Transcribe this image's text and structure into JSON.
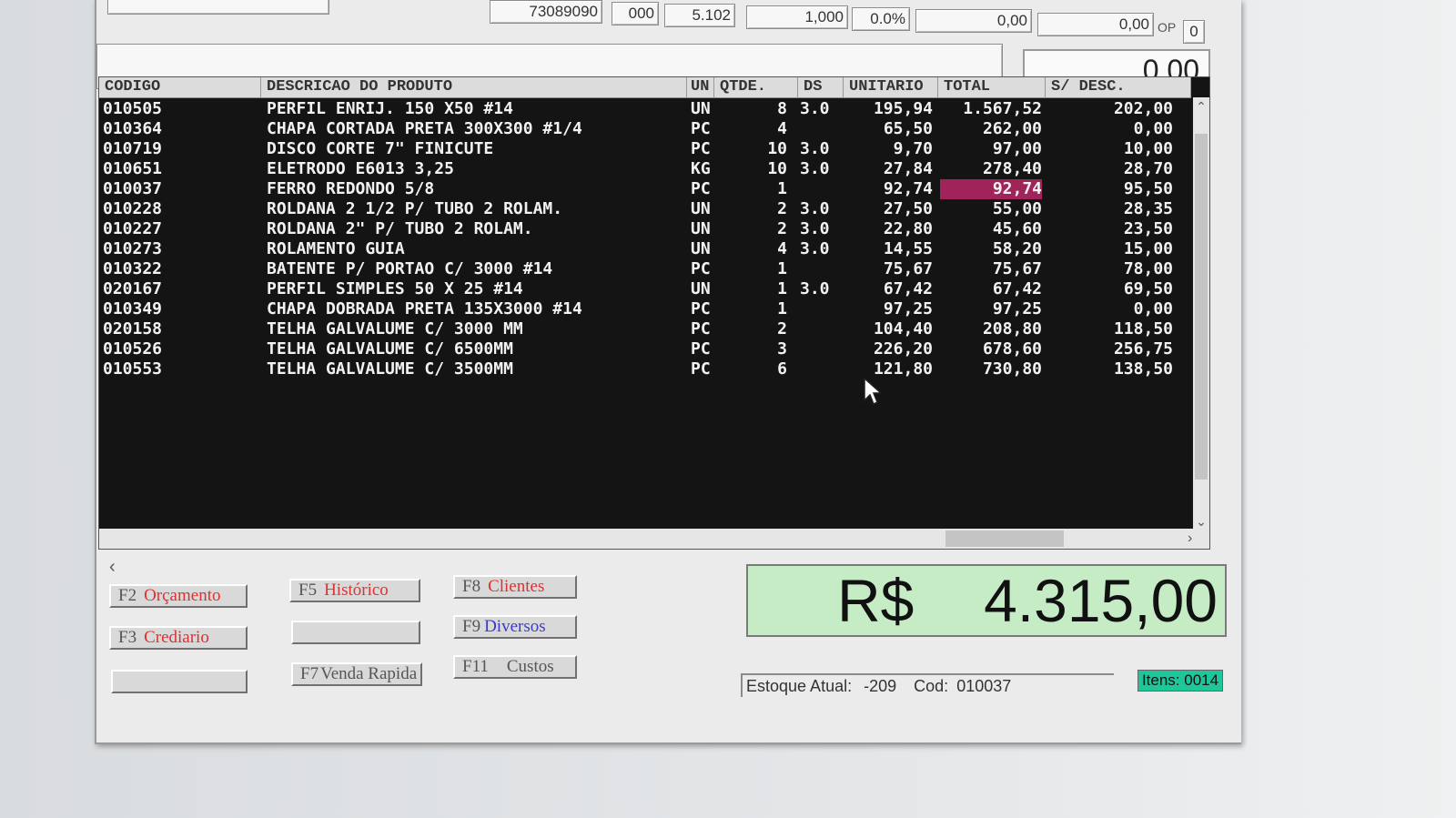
{
  "top_fields": {
    "code": "73089090",
    "f2": "000",
    "f3": "5.102",
    "qty": "1,000",
    "pct": "0.0%",
    "val1": "0,00",
    "val2": "0,00",
    "op_label": "OP",
    "op_value": "0",
    "subtotal": "0,00"
  },
  "grid": {
    "headers": {
      "codigo": "CODIGO",
      "descricao": "DESCRICAO DO PRODUTO",
      "un": "UN",
      "qtde": "QTDE.",
      "ds": "DS",
      "unitario": "UNITARIO",
      "total": "TOTAL",
      "sdesc": "S/ DESC."
    },
    "rows": [
      {
        "codigo": "010505",
        "descricao": "PERFIL ENRIJ. 150 X50 #14",
        "un": "UN",
        "qtde": "8",
        "ds": "3.0",
        "unitario": "195,94",
        "total": "1.567,52",
        "sdesc": "202,00"
      },
      {
        "codigo": "010364",
        "descricao": "CHAPA CORTADA PRETA 300X300 #1/4",
        "un": "PC",
        "qtde": "4",
        "ds": "",
        "unitario": "65,50",
        "total": "262,00",
        "sdesc": "0,00"
      },
      {
        "codigo": "010719",
        "descricao": "DISCO CORTE 7\" FINICUTE",
        "un": "PC",
        "qtde": "10",
        "ds": "3.0",
        "unitario": "9,70",
        "total": "97,00",
        "sdesc": "10,00"
      },
      {
        "codigo": "010651",
        "descricao": "ELETRODO E6013 3,25",
        "un": "KG",
        "qtde": "10",
        "ds": "3.0",
        "unitario": "27,84",
        "total": "278,40",
        "sdesc": "28,70"
      },
      {
        "codigo": "010037",
        "descricao": "FERRO REDONDO 5/8",
        "un": "PC",
        "qtde": "1",
        "ds": "",
        "unitario": "92,74",
        "total": "92,74",
        "sdesc": "95,50"
      },
      {
        "codigo": "010228",
        "descricao": "ROLDANA 2 1/2 P/ TUBO 2 ROLAM.",
        "un": "UN",
        "qtde": "2",
        "ds": "3.0",
        "unitario": "27,50",
        "total": "55,00",
        "sdesc": "28,35"
      },
      {
        "codigo": "010227",
        "descricao": "ROLDANA 2\" P/ TUBO 2 ROLAM.",
        "un": "UN",
        "qtde": "2",
        "ds": "3.0",
        "unitario": "22,80",
        "total": "45,60",
        "sdesc": "23,50"
      },
      {
        "codigo": "010273",
        "descricao": "ROLAMENTO GUIA",
        "un": "UN",
        "qtde": "4",
        "ds": "3.0",
        "unitario": "14,55",
        "total": "58,20",
        "sdesc": "15,00"
      },
      {
        "codigo": "010322",
        "descricao": "BATENTE P/ PORTAO C/ 3000 #14",
        "un": "PC",
        "qtde": "1",
        "ds": "",
        "unitario": "75,67",
        "total": "75,67",
        "sdesc": "78,00"
      },
      {
        "codigo": "020167",
        "descricao": "PERFIL SIMPLES 50 X 25 #14",
        "un": "UN",
        "qtde": "1",
        "ds": "3.0",
        "unitario": "67,42",
        "total": "67,42",
        "sdesc": "69,50"
      },
      {
        "codigo": "010349",
        "descricao": "CHAPA DOBRADA PRETA 135X3000 #14",
        "un": "PC",
        "qtde": "1",
        "ds": "",
        "unitario": "97,25",
        "total": "97,25",
        "sdesc": "0,00"
      },
      {
        "codigo": "020158",
        "descricao": "TELHA GALVALUME C/ 3000 MM",
        "un": "PC",
        "qtde": "2",
        "ds": "",
        "unitario": "104,40",
        "total": "208,80",
        "sdesc": "118,50"
      },
      {
        "codigo": "010526",
        "descricao": "TELHA GALVALUME C/ 6500MM",
        "un": "PC",
        "qtde": "3",
        "ds": "",
        "unitario": "226,20",
        "total": "678,60",
        "sdesc": "256,75"
      },
      {
        "codigo": "010553",
        "descricao": "TELHA GALVALUME C/ 3500MM",
        "un": "PC",
        "qtde": "6",
        "ds": "",
        "unitario": "121,80",
        "total": "730,80",
        "sdesc": "138,50"
      }
    ],
    "highlight_color": "#a0245a",
    "highlight_row": 4
  },
  "buttons": {
    "f2": {
      "key": "F2",
      "label": "Orçamento"
    },
    "f3": {
      "key": "F3",
      "label": "Crediario"
    },
    "f5": {
      "key": "F5",
      "label": "Histórico"
    },
    "f7": {
      "key": "F7",
      "label": "Venda Rapida"
    },
    "f8": {
      "key": "F8",
      "label": "Clientes"
    },
    "f9": {
      "key": "F9",
      "label": "Diversos"
    },
    "f11": {
      "key": "F11",
      "label": "Custos"
    }
  },
  "total": {
    "currency": "R$",
    "value": "4.315,00",
    "bg_color": "#c6ecc6"
  },
  "status": {
    "estoque_label": "Estoque Atual:",
    "estoque_value": "-209",
    "cod_label": "Cod:",
    "cod_value": "010037",
    "itens": "Itens: 0014",
    "itens_color": "#1fc69a"
  },
  "icons": {
    "scroll_up": "chevron-up-icon",
    "scroll_down": "chevron-down-icon",
    "scroll_left": "chevron-left-icon",
    "scroll_right": "chevron-right-icon",
    "cursor": "mouse-pointer-icon"
  }
}
